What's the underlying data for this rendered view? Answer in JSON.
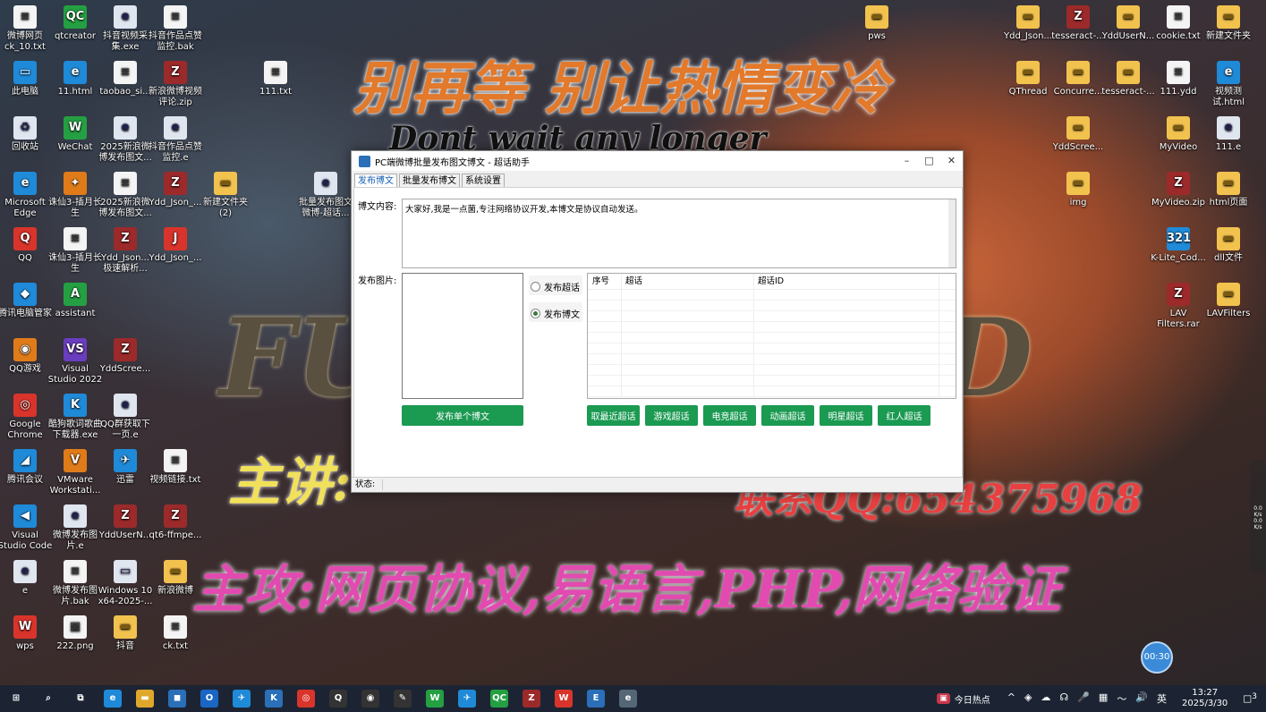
{
  "wallpaper": {
    "line1": "别再等 别让热情变冷",
    "line2": "Dont wait any longer",
    "line3": "FUC",
    "line3b": "D",
    "line4": "主讲:",
    "line5": "联系QQ:654375968",
    "line6": "主攻:网页协议,易语言,PHP,网络验证"
  },
  "desktop_left": [
    {
      "label": "微博网页ck_10.txt",
      "glyph": "≡",
      "cls": "g-doc"
    },
    {
      "label": "qtcreator",
      "glyph": "QC",
      "cls": "g-green"
    },
    {
      "label": "抖音视频采集.exe",
      "glyph": "e",
      "cls": "g-e"
    },
    {
      "label": "抖音作品点赞监控.bak",
      "glyph": "≡",
      "cls": "g-doc"
    },
    {
      "label": "此电脑",
      "glyph": "▭",
      "cls": "g-app"
    },
    {
      "label": "11.html",
      "glyph": "e",
      "cls": "g-app"
    },
    {
      "label": "taobao_si...",
      "glyph": "≡",
      "cls": "g-doc"
    },
    {
      "label": "新浪微博视频评论.zip",
      "glyph": "Z",
      "cls": "g-zip"
    },
    {
      "label": "111.txt",
      "glyph": "≡",
      "cls": "g-doc"
    },
    {
      "label": "回收站",
      "glyph": "♻",
      "cls": "g-e"
    },
    {
      "label": "WeChat",
      "glyph": "W",
      "cls": "g-green"
    },
    {
      "label": "2025新浪微博发布图文...",
      "glyph": "e",
      "cls": "g-e"
    },
    {
      "label": "抖音作品点赞监控.e",
      "glyph": "e",
      "cls": "g-e"
    },
    {
      "label": "Microsoft Edge",
      "glyph": "e",
      "cls": "g-app"
    },
    {
      "label": "诛仙3-插月长生",
      "glyph": "✦",
      "cls": "g-orange"
    },
    {
      "label": "2025新浪微博发布图文...",
      "glyph": "≡",
      "cls": "g-doc"
    },
    {
      "label": "Ydd_Json_...",
      "glyph": "Z",
      "cls": "g-zip"
    },
    {
      "label": "新建文件夹(2)",
      "glyph": "▬",
      "cls": "g-folder"
    },
    {
      "label": "批量发布图文微博-超话...",
      "glyph": "e",
      "cls": "g-e"
    },
    {
      "label": "QQ",
      "glyph": "Q",
      "cls": "g-red"
    },
    {
      "label": "诛仙3-插月长生",
      "glyph": "≡",
      "cls": "g-doc"
    },
    {
      "label": "Ydd_Json...极速解析...",
      "glyph": "Z",
      "cls": "g-zip"
    },
    {
      "label": "Ydd_Json_...",
      "glyph": "J",
      "cls": "g-red"
    },
    {
      "label": "腾讯电脑管家",
      "glyph": "◆",
      "cls": "g-app"
    },
    {
      "label": "assistant",
      "glyph": "A",
      "cls": "g-green"
    },
    {
      "label": "QQ游戏",
      "glyph": "◉",
      "cls": "g-orange"
    },
    {
      "label": "Visual Studio 2022",
      "glyph": "VS",
      "cls": "g-purple"
    },
    {
      "label": "YddScree...",
      "glyph": "Z",
      "cls": "g-zip"
    },
    {
      "label": "Google Chrome",
      "glyph": "◎",
      "cls": "g-red"
    },
    {
      "label": "酷狗歌词歌曲下载器.exe",
      "glyph": "K",
      "cls": "g-app"
    },
    {
      "label": "QQ群获取下一页.e",
      "glyph": "e",
      "cls": "g-e"
    },
    {
      "label": "腾讯会议",
      "glyph": "◢",
      "cls": "g-app"
    },
    {
      "label": "VMware Workstati...",
      "glyph": "V",
      "cls": "g-orange"
    },
    {
      "label": "迅雷",
      "glyph": "✈",
      "cls": "g-app"
    },
    {
      "label": "视频链接.txt",
      "glyph": "≡",
      "cls": "g-doc"
    },
    {
      "label": "Visual Studio Code",
      "glyph": "◀",
      "cls": "g-app"
    },
    {
      "label": "微博发布图片.e",
      "glyph": "e",
      "cls": "g-e"
    },
    {
      "label": "YddUserN...",
      "glyph": "Z",
      "cls": "g-zip"
    },
    {
      "label": "qt6-ffmpe...",
      "glyph": "Z",
      "cls": "g-zip"
    },
    {
      "label": "e",
      "glyph": "e",
      "cls": "g-e"
    },
    {
      "label": "微博发布图片.bak",
      "glyph": "≡",
      "cls": "g-doc"
    },
    {
      "label": "Windows 10 x64-2025-...",
      "glyph": "▭",
      "cls": "g-e"
    },
    {
      "label": "新浪微博",
      "glyph": "▬",
      "cls": "g-folder"
    },
    {
      "label": "wps",
      "glyph": "W",
      "cls": "g-red"
    },
    {
      "label": "222.png",
      "glyph": "▣",
      "cls": "g-doc"
    },
    {
      "label": "抖音",
      "glyph": "▬",
      "cls": "g-folder"
    },
    {
      "label": "ck.txt",
      "glyph": "≡",
      "cls": "g-doc"
    }
  ],
  "desktop_right": [
    {
      "label": "pws",
      "glyph": "▬",
      "cls": "g-folder"
    },
    {
      "label": "Ydd_Json...",
      "glyph": "▬",
      "cls": "g-folder"
    },
    {
      "label": "tesseract-...",
      "glyph": "Z",
      "cls": "g-zip"
    },
    {
      "label": "YddUserN...",
      "glyph": "▬",
      "cls": "g-folder"
    },
    {
      "label": "cookie.txt",
      "glyph": "≡",
      "cls": "g-doc"
    },
    {
      "label": "新建文件夹",
      "glyph": "▬",
      "cls": "g-folder"
    },
    {
      "label": "QThread",
      "glyph": "▬",
      "cls": "g-folder"
    },
    {
      "label": "Concurre...",
      "glyph": "▬",
      "cls": "g-folder"
    },
    {
      "label": "tesseract-...",
      "glyph": "▬",
      "cls": "g-folder"
    },
    {
      "label": "111.ydd",
      "glyph": "≡",
      "cls": "g-doc"
    },
    {
      "label": "视频测试.html",
      "glyph": "e",
      "cls": "g-app"
    },
    {
      "label": "YddScree...",
      "glyph": "▬",
      "cls": "g-folder"
    },
    {
      "label": "MyVideo",
      "glyph": "▬",
      "cls": "g-folder"
    },
    {
      "label": "111.e",
      "glyph": "e",
      "cls": "g-e"
    },
    {
      "label": "img",
      "glyph": "▬",
      "cls": "g-folder"
    },
    {
      "label": "MyVideo.zip",
      "glyph": "Z",
      "cls": "g-zip"
    },
    {
      "label": "html页面",
      "glyph": "▬",
      "cls": "g-folder"
    },
    {
      "label": "K-Lite_Cod...",
      "glyph": "321",
      "cls": "g-app"
    },
    {
      "label": "dll文件",
      "glyph": "▬",
      "cls": "g-folder"
    },
    {
      "label": "LAV Filters.rar",
      "glyph": "Z",
      "cls": "g-zip"
    },
    {
      "label": "LAVFilters",
      "glyph": "▬",
      "cls": "g-folder"
    }
  ],
  "window": {
    "title": "PC端微博批量发布图文博文 - 超话助手",
    "controls": {
      "minimize": "–",
      "maximize": "□",
      "close": "✕"
    },
    "tabs": [
      "发布博文",
      "批量发布博文",
      "系统设置"
    ],
    "content_label": "博文内容:",
    "content_value": "大家好,我是一点菌,专注网络协议开发,本博文是协议自动发送。",
    "image_label": "发布图片:",
    "radio_chaohua": "发布超话",
    "radio_bowen": "发布博文",
    "grid_headers": [
      "序号",
      "超话",
      "超话ID"
    ],
    "publish_single_button": "发布单个博文",
    "topic_buttons": [
      "取最近超话",
      "游戏超话",
      "电竞超话",
      "动画超话",
      "明星超话",
      "红人超话"
    ],
    "status_label": "状态:"
  },
  "timer": "00:30",
  "sidebar_mini": [
    "0.0",
    "K/s",
    "0.0",
    "K/s"
  ],
  "taskbar": {
    "apps": [
      {
        "name": "start",
        "glyph": "⊞",
        "color": "#1c2433"
      },
      {
        "name": "search",
        "glyph": "⌕",
        "color": "#1c2433"
      },
      {
        "name": "task-view",
        "glyph": "⧉",
        "color": "#1c2433"
      },
      {
        "name": "edge",
        "glyph": "e",
        "color": "#1f8ad8"
      },
      {
        "name": "explorer",
        "glyph": "▬",
        "color": "#e0a82a"
      },
      {
        "name": "store",
        "glyph": "◼",
        "color": "#2a6fb8"
      },
      {
        "name": "outlook",
        "glyph": "O",
        "color": "#1a66c4"
      },
      {
        "name": "xunlei",
        "glyph": "✈",
        "color": "#1f8ad8"
      },
      {
        "name": "kugou",
        "glyph": "K",
        "color": "#2a6fb8"
      },
      {
        "name": "chrome",
        "glyph": "◎",
        "color": "#d9342b"
      },
      {
        "name": "qq",
        "glyph": "Q",
        "color": "#333"
      },
      {
        "name": "obs",
        "glyph": "◉",
        "color": "#333"
      },
      {
        "name": "pen",
        "glyph": "✎",
        "color": "#333"
      },
      {
        "name": "wechat",
        "glyph": "W",
        "color": "#24a043"
      },
      {
        "name": "xunlei2",
        "glyph": "✈",
        "color": "#1f8ad8"
      },
      {
        "name": "qtcreator",
        "glyph": "QC",
        "color": "#24a043"
      },
      {
        "name": "zip",
        "glyph": "Z",
        "color": "#9c2a2a"
      },
      {
        "name": "wps",
        "glyph": "W",
        "color": "#d9342b"
      },
      {
        "name": "editor",
        "glyph": "E",
        "color": "#2a6fb8"
      },
      {
        "name": "app-e",
        "glyph": "e",
        "color": "#567"
      }
    ],
    "news": "今日热点",
    "tray_icons": [
      "^",
      "◈",
      "☁",
      "☊",
      "🎤",
      "▦",
      "〜",
      "🔊",
      "英"
    ],
    "time": "13:27",
    "date": "2025/3/30",
    "notif": "3"
  }
}
